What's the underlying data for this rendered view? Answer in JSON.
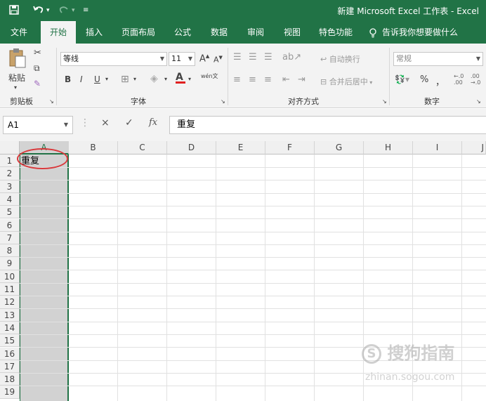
{
  "window": {
    "title": "新建 Microsoft Excel 工作表 - Excel"
  },
  "quick_access": {
    "save_icon": "save-icon",
    "undo_icon": "undo-icon",
    "redo_icon": "redo-icon",
    "customize_icon": "customize-icon"
  },
  "tabs": [
    {
      "label": "文件"
    },
    {
      "label": "开始"
    },
    {
      "label": "插入"
    },
    {
      "label": "页面布局"
    },
    {
      "label": "公式"
    },
    {
      "label": "数据"
    },
    {
      "label": "审阅"
    },
    {
      "label": "视图"
    },
    {
      "label": "特色功能"
    }
  ],
  "tell_me": "告诉我你想要做什么",
  "ribbon": {
    "clipboard": {
      "paste": "粘贴",
      "label": "剪贴板"
    },
    "font": {
      "name": "等线",
      "size": "11",
      "label": "字体",
      "bold": "B",
      "italic": "I",
      "underline": "U",
      "pinyin": "wén文",
      "grow": "A",
      "shrink": "A"
    },
    "alignment": {
      "wrap": "自动换行",
      "merge": "合并后居中",
      "label": "对齐方式"
    },
    "number": {
      "format": "常规",
      "percent": "%",
      "comma": "，",
      "label": "数字"
    }
  },
  "formula_bar": {
    "name_box": "A1",
    "fx": "fx",
    "cancel": "×",
    "enter": "✓",
    "content": "重复"
  },
  "columns": [
    "A",
    "B",
    "C",
    "D",
    "E",
    "F",
    "G",
    "H",
    "I",
    "J"
  ],
  "rows": [
    "1",
    "2",
    "3",
    "4",
    "5",
    "6",
    "7",
    "8",
    "9",
    "10",
    "11",
    "12",
    "13",
    "14",
    "15",
    "16",
    "17",
    "18",
    "19"
  ],
  "cells": {
    "A1": "重复"
  },
  "watermark": {
    "text": "搜狗指南",
    "url": "zhinan.sogou.com"
  },
  "colors": {
    "accent": "#217346",
    "highlight_circle": "#d9393c"
  }
}
